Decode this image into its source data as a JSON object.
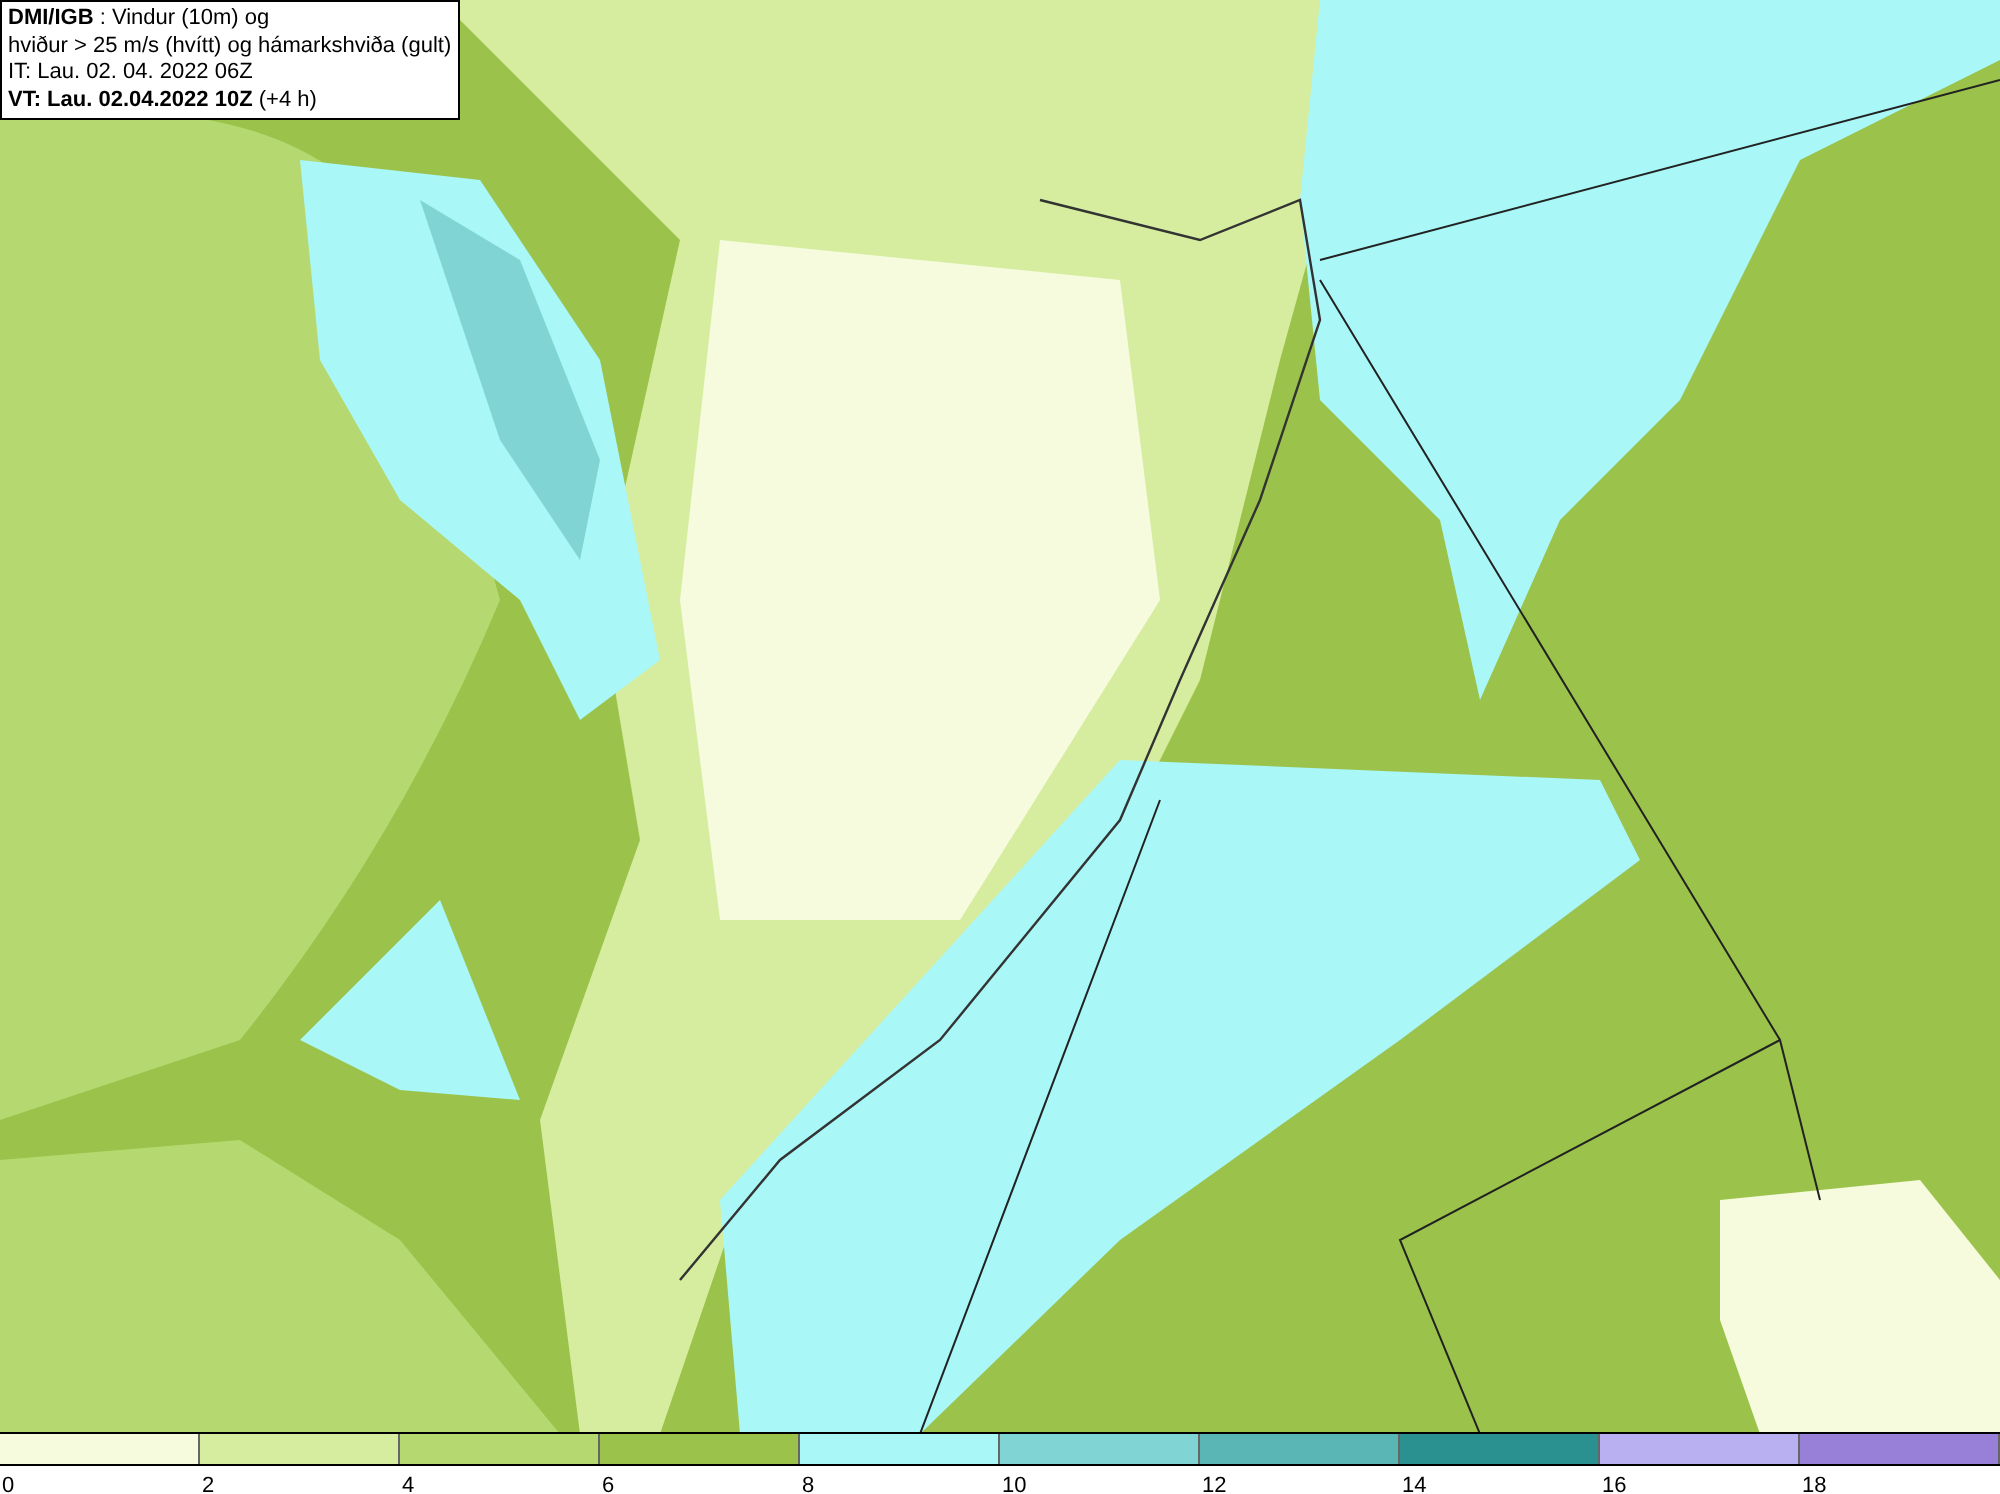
{
  "title_box": {
    "lines": [
      "**DMI/IGB** : Vindur (10m) og",
      "hviður > 25 m/s (hvítt) og hámarkshviða (gult)",
      "IT: Lau. 02. 04. 2022 06Z",
      "**VT: Lau. 02.04.2022 10Z** (+4 h)"
    ]
  },
  "legend": [
    {
      "color": "#f5fbdc",
      "label": "0"
    },
    {
      "color": "#d6eda0",
      "label": "2"
    },
    {
      "color": "#b5d970",
      "label": "4"
    },
    {
      "color": "#9bc24a",
      "label": "6"
    },
    {
      "color": "#a9f7f7",
      "label": "8"
    },
    {
      "color": "#80d4d4",
      "label": "10"
    },
    {
      "color": "#5ab5b5",
      "label": "12"
    },
    {
      "color": "#2a9090",
      "label": "14"
    },
    {
      "color": "#b8b0f0",
      "label": "16"
    },
    {
      "color": "#9880d8",
      "label": "18"
    }
  ]
}
